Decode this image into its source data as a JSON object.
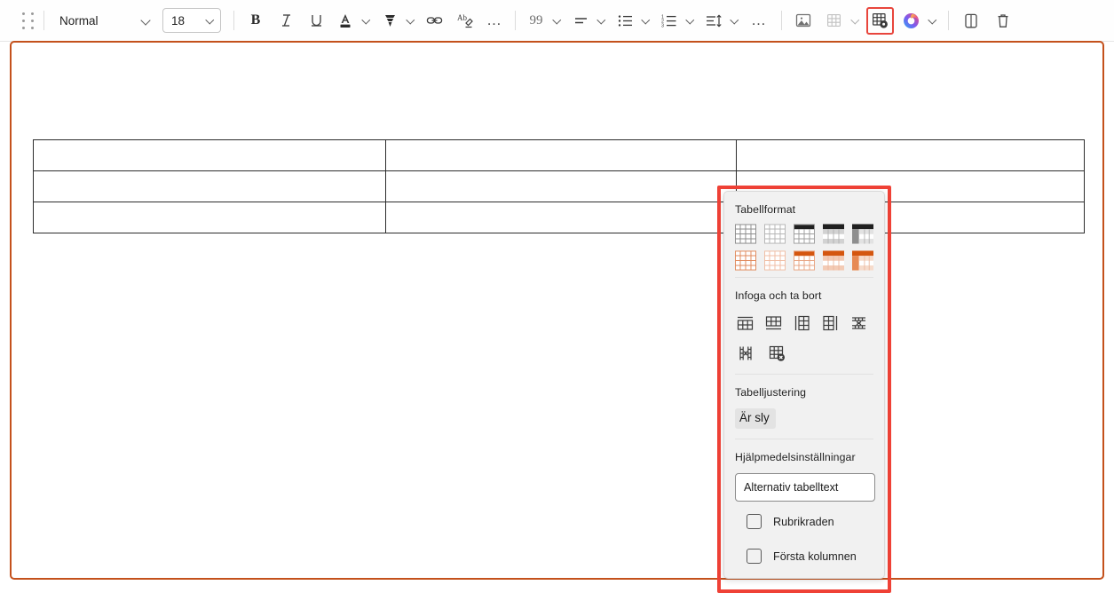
{
  "toolbar": {
    "drag_handle": "drag-handle",
    "paragraph_style": {
      "value": "Normal",
      "options": [
        "Normal"
      ]
    },
    "font_size": {
      "value": "18",
      "options": [
        "18"
      ]
    },
    "bold_label": "B",
    "italic_label": "I",
    "underline_label": "U",
    "font_color_label": "A",
    "highlight_label": "highlight",
    "link_label": "link",
    "clear_format_label": "Ab",
    "more_text_label": "…",
    "quote_label": "99",
    "align_label": "align",
    "bullet_list_label": "bulleted-list",
    "numbered_list_label": "numbered-list",
    "line_spacing_label": "line-spacing",
    "more_para_label": "…",
    "insert_image_label": "insert-image",
    "insert_table_label": "insert-table",
    "table_settings_label": "table-settings",
    "copilot_label": "copilot",
    "duplicate_label": "duplicate",
    "delete_label": "delete",
    "numbered_digits": [
      "1",
      "2",
      "3"
    ]
  },
  "document": {
    "table": {
      "rows": 3,
      "cols": 3,
      "cells": [
        [
          "",
          "",
          ""
        ],
        [
          "",
          "",
          ""
        ],
        [
          "",
          "",
          ""
        ]
      ]
    }
  },
  "panel": {
    "sections": {
      "table_format": {
        "title": "Tabellformat",
        "swatches_gray": [
          "plain-grid",
          "light-grid",
          "header-dark",
          "header-banded",
          "header-first-col"
        ],
        "swatches_orange": [
          "plain-grid-orange",
          "light-grid-orange",
          "header-orange",
          "header-banded-orange",
          "header-first-col-orange"
        ]
      },
      "insert_delete": {
        "title": "Infoga och ta bort",
        "buttons_row1": [
          "insert-row-above",
          "insert-row-below",
          "insert-column-left",
          "insert-column-right",
          "delete-row"
        ],
        "buttons_row2": [
          "delete-column",
          "delete-table"
        ]
      },
      "table_alignment": {
        "title": "Tabelljustering",
        "selected_label": "Är sly"
      },
      "accessibility": {
        "title": "Hjälpmedelsinställningar",
        "alt_text": {
          "value": "Alternativ tabelltext",
          "placeholder": "Alternativ tabelltext"
        },
        "checkboxes": [
          {
            "label": "Rubrikraden",
            "checked": false
          },
          {
            "label": "Första kolumnen",
            "checked": false
          }
        ]
      }
    }
  },
  "colors": {
    "accent_orange": "#c4511c",
    "highlight_red": "#ef4136",
    "panel_bg": "#f1f1f1",
    "swatch_orange": "#d4560f",
    "toolbar_icon": "#4a4a4a"
  }
}
